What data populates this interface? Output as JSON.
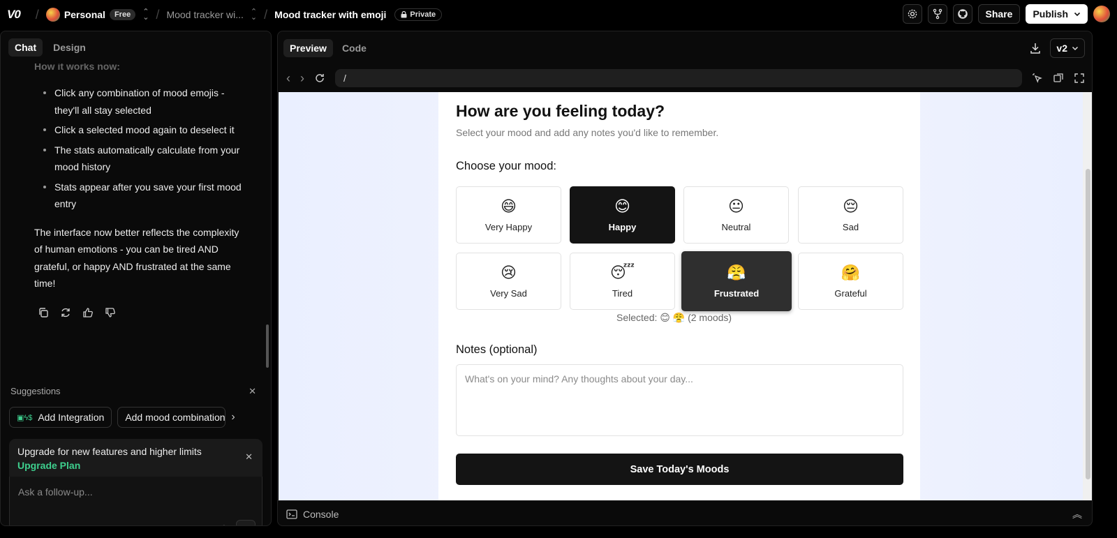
{
  "topbar": {
    "logo": "V0",
    "workspace": "Personal",
    "plan_badge": "Free",
    "project": "Mood tracker wi...",
    "chat_title": "Mood tracker with emoji",
    "visibility": "Private",
    "share_label": "Share",
    "publish_label": "Publish"
  },
  "left_panel": {
    "tabs": [
      "Chat",
      "Design"
    ],
    "faded_text": "How it works now:",
    "bullets": [
      "Click any combination of mood emojis - they'll all stay selected",
      "Click a selected mood again to deselect it",
      "The stats automatically calculate from your mood history",
      "Stats appear after you save your first mood entry"
    ],
    "paragraph": "The interface now better reflects the complexity of human emotions - you can be tired AND grateful, or happy AND frustrated at the same time!",
    "suggestions_label": "Suggestions",
    "suggestion_chips": [
      "Add Integration",
      "Add mood combinations"
    ],
    "upgrade_text": "Upgrade for new features and higher limits",
    "upgrade_link": "Upgrade Plan",
    "composer_placeholder": "Ask a follow-up..."
  },
  "right_panel": {
    "tabs": [
      "Preview",
      "Code"
    ],
    "version": "v2",
    "url": "/",
    "console_label": "Console"
  },
  "app": {
    "title": "How are you feeling today?",
    "subtitle": "Select your mood and add any notes you'd like to remember.",
    "choose_label": "Choose your mood:",
    "moods": [
      {
        "emoji": "😄",
        "label": "Very Happy",
        "selected": false
      },
      {
        "emoji": "😊",
        "label": "Happy",
        "selected": true
      },
      {
        "emoji": "😐",
        "label": "Neutral",
        "selected": false
      },
      {
        "emoji": "😔",
        "label": "Sad",
        "selected": false
      },
      {
        "emoji": "😢",
        "label": "Very Sad",
        "selected": false
      },
      {
        "emoji": "😴",
        "label": "Tired",
        "selected": false
      },
      {
        "emoji": "😤",
        "label": "Frustrated",
        "selected": true
      },
      {
        "emoji": "🤗",
        "label": "Grateful",
        "selected": false
      }
    ],
    "selected_prefix": "Selected:",
    "selected_emojis": "😊 😤",
    "selected_count": "(2 moods)",
    "notes_label": "Notes (optional)",
    "notes_placeholder": "What's on your mind? Any thoughts about your day...",
    "save_label": "Save Today's Moods"
  }
}
